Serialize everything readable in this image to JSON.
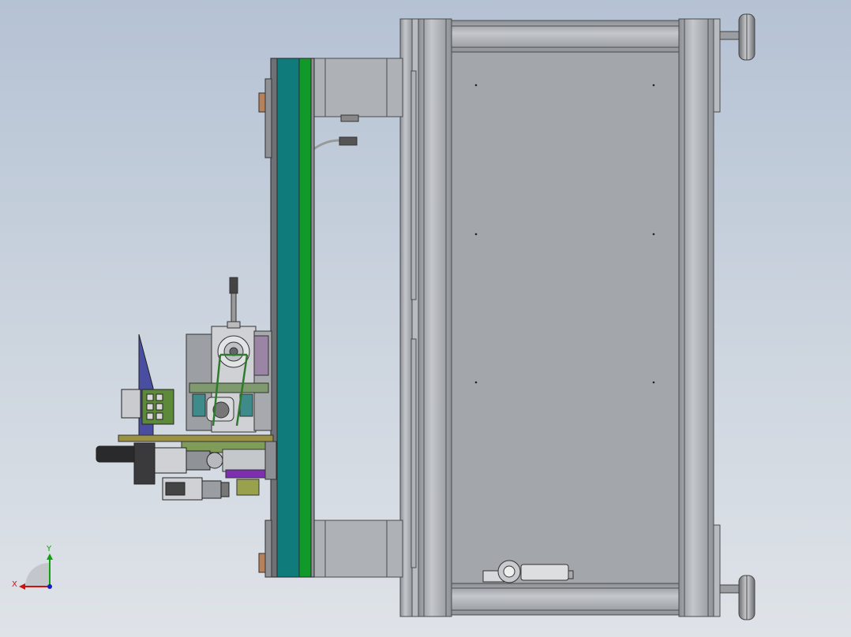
{
  "viewport": {
    "background_top": "#b5c2d4",
    "background_bottom": "#dfe3e8"
  },
  "triad": {
    "x_label": "X",
    "y_label": "Y",
    "x_color": "#d01010",
    "y_color": "#10a010",
    "z_color": "#1020c0"
  },
  "colors": {
    "frame_grey": "#a6a9ad",
    "frame_edge": "#4a4c50",
    "panel_grey": "#9fa2a6",
    "teal_plate": "#0f7b7b",
    "green_plate": "#119a2a",
    "purple_part": "#6a2aa8",
    "pcb_green": "#5d8a3a",
    "blue_bracket": "#4a4ea0",
    "motor_black": "#2a2a2c",
    "foot_dark": "#555"
  }
}
